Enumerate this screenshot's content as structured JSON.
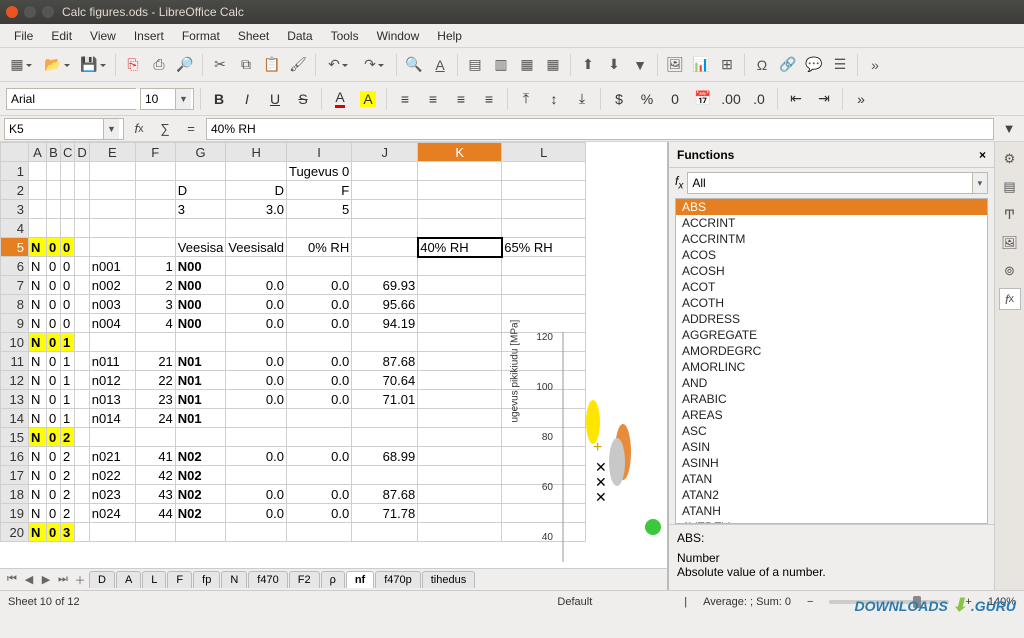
{
  "window": {
    "title": "Calc figures.ods - LibreOffice Calc"
  },
  "menu": [
    "File",
    "Edit",
    "View",
    "Insert",
    "Format",
    "Sheet",
    "Data",
    "Tools",
    "Window",
    "Help"
  ],
  "font": {
    "name": "Arial",
    "size": "10"
  },
  "cellref": "K5",
  "formula": "40% RH",
  "columns": [
    "A",
    "B",
    "C",
    "D",
    "E",
    "F",
    "G",
    "H",
    "I",
    "J",
    "K",
    "L"
  ],
  "row_numbers": [
    1,
    2,
    3,
    4,
    5,
    6,
    7,
    8,
    9,
    10,
    11,
    12,
    13,
    14,
    15,
    16,
    17,
    18,
    19,
    20
  ],
  "cells": {
    "I1": "Tugevus 0",
    "G2": "D",
    "H2": "D",
    "I2": "F",
    "G3": "3",
    "H3": "3.0",
    "I3": "5",
    "A5": "N",
    "B5": "0",
    "C5": "0",
    "G5": "Veesisa",
    "H5": "Veesisald",
    "I5": "0% RH",
    "K5": "40% RH",
    "L5": "65% RH",
    "A6": "N",
    "B6": "0",
    "C6": "0",
    "E6": "n001",
    "F6": "1",
    "G6": "N00",
    "A7": "N",
    "B7": "0",
    "C7": "0",
    "E7": "n002",
    "F7": "2",
    "G7": "N00",
    "H7": "0.0",
    "I7": "0.0",
    "J7": "69.93",
    "A8": "N",
    "B8": "0",
    "C8": "0",
    "E8": "n003",
    "F8": "3",
    "G8": "N00",
    "H8": "0.0",
    "I8": "0.0",
    "J8": "95.66",
    "A9": "N",
    "B9": "0",
    "C9": "0",
    "E9": "n004",
    "F9": "4",
    "G9": "N00",
    "H9": "0.0",
    "I9": "0.0",
    "J9": "94.19",
    "A10": "N",
    "B10": "0",
    "C10": "1",
    "A11": "N",
    "B11": "0",
    "C11": "1",
    "E11": "n011",
    "F11": "21",
    "G11": "N01",
    "H11": "0.0",
    "I11": "0.0",
    "J11": "87.68",
    "A12": "N",
    "B12": "0",
    "C12": "1",
    "E12": "n012",
    "F12": "22",
    "G12": "N01",
    "H12": "0.0",
    "I12": "0.0",
    "J12": "70.64",
    "A13": "N",
    "B13": "0",
    "C13": "1",
    "E13": "n013",
    "F13": "23",
    "G13": "N01",
    "H13": "0.0",
    "I13": "0.0",
    "J13": "71.01",
    "A14": "N",
    "B14": "0",
    "C14": "1",
    "E14": "n014",
    "F14": "24",
    "G14": "N01",
    "A15": "N",
    "B15": "0",
    "C15": "2",
    "A16": "N",
    "B16": "0",
    "C16": "2",
    "E16": "n021",
    "F16": "41",
    "G16": "N02",
    "H16": "0.0",
    "I16": "0.0",
    "J16": "68.99",
    "A17": "N",
    "B17": "0",
    "C17": "2",
    "E17": "n022",
    "F17": "42",
    "G17": "N02",
    "A18": "N",
    "B18": "0",
    "C18": "2",
    "E18": "n023",
    "F18": "43",
    "G18": "N02",
    "H18": "0.0",
    "I18": "0.0",
    "J18": "87.68",
    "A19": "N",
    "B19": "0",
    "C19": "2",
    "E19": "n024",
    "F19": "44",
    "G19": "N02",
    "H19": "0.0",
    "I19": "0.0",
    "J19": "71.78",
    "A20": "N",
    "B20": "0",
    "C20": "3"
  },
  "highlight_rows": [
    5,
    10,
    15,
    20
  ],
  "bold_cells": [
    "G6",
    "G7",
    "G8",
    "G9",
    "G11",
    "G12",
    "G13",
    "G14",
    "G16",
    "G17",
    "G18",
    "G19"
  ],
  "num_cols": [
    "F",
    "H",
    "I",
    "J"
  ],
  "col_widths": {
    "A": 18,
    "B": 14,
    "C": 14,
    "D": 14,
    "E": 46,
    "F": 40,
    "G": 40,
    "H": 58,
    "I": 58,
    "J": 66,
    "K": 84,
    "L": 84
  },
  "tabs": [
    "D",
    "A",
    "L",
    "F",
    "fp",
    "N",
    "f470",
    "F2",
    "ρ",
    "nf",
    "f470p",
    "tihedus"
  ],
  "active_tab": "nf",
  "status": {
    "sheet": "Sheet 10 of 12",
    "style": "Default",
    "agg": "Average: ; Sum: 0",
    "zoom": "140%"
  },
  "sidebar": {
    "title": "Functions",
    "category": "All",
    "functions": [
      "ABS",
      "ACCRINT",
      "ACCRINTM",
      "ACOS",
      "ACOSH",
      "ACOT",
      "ACOTH",
      "ADDRESS",
      "AGGREGATE",
      "AMORDEGRC",
      "AMORLINC",
      "AND",
      "ARABIC",
      "AREAS",
      "ASC",
      "ASIN",
      "ASINH",
      "ATAN",
      "ATAN2",
      "ATANH",
      "AVEDEV"
    ],
    "selected": "ABS",
    "desc_head": "ABS:",
    "desc_sub": "Number",
    "desc_body": "Absolute value of a number."
  },
  "chart_data": {
    "type": "scatter",
    "ylabel": "ugevus pikikiudu [MPa]",
    "yticks": [
      40.0,
      60.0,
      80.0,
      100.0,
      120.0
    ]
  },
  "watermark": {
    "brand": "DOWNLOADS",
    "suffix": ".GURU"
  }
}
